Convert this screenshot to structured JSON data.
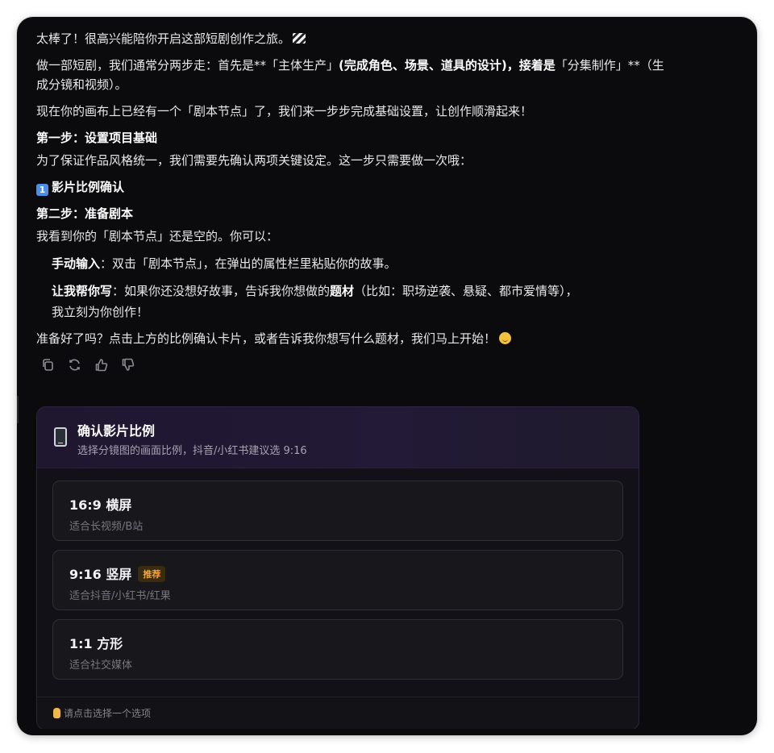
{
  "messages": {
    "intro": "太棒了！很高兴能陪你开启这部短剧创作之旅。",
    "overview_1": "做一部短剧，我们通常分两步走：首先是**「主体生产」",
    "overview_2": "(完成角色、场景、道具的设计)，接着是",
    "overview_3": "「分集制作」**（生成分镜和视频）。",
    "canvas_note": "现在你的画布上已经有一个「剧本节点」了，我们来一步步完成基础设置，让创作顺滑起来！",
    "step1_title": "第一步：设置项目基础",
    "step1_desc": "为了保证作品风格统一，我们需要先确认两项关键设定。这一步只需要做一次哦：",
    "step1_item_num": "1",
    "step1_item": "影片比例确认",
    "step2_title": "第二步：准备剧本",
    "step2_desc": "我看到你的「剧本节点」还是空的。你可以：",
    "opt_manual_label": "手动输入",
    "opt_manual_text": "：双击「剧本节点」，在弹出的属性栏里粘贴你的故事。",
    "opt_write_label": "让我帮你写",
    "opt_write_text_1": "：如果你还没想好故事，告诉我你想做的",
    "opt_write_bold": "题材",
    "opt_write_text_2": "（比如：职场逆袭、悬疑、都市爱情等），",
    "opt_write_text_3": "我立刻为你创作！",
    "closing": "准备好了吗？点击上方的比例确认卡片，或者告诉我你想写什么题材，我们马上开始！"
  },
  "actions": {
    "icons": [
      "copy-icon",
      "regenerate-icon",
      "thumbs-up-icon",
      "thumbs-down-icon"
    ]
  },
  "card": {
    "icon": "mobile-phone-icon",
    "title": "确认影片比例",
    "subtitle": "选择分镜图的画面比例，抖音/小红书建议选 9:16",
    "options": [
      {
        "title": "16:9 横屏",
        "desc": "适合长视频/B站",
        "badge": ""
      },
      {
        "title": "9:16 竖屏",
        "desc": "适合抖音/小红书/红果",
        "badge": "推荐"
      },
      {
        "title": "1:1 方形",
        "desc": "适合社交媒体",
        "badge": ""
      }
    ],
    "hint": "请点击选择一个选项"
  },
  "colors": {
    "background": "#0b0b0d",
    "card_header": "#221a36",
    "badge_text": "#f2a43a",
    "badge_bg": "#3a2a0e",
    "keycap": "#4a8ee9"
  }
}
